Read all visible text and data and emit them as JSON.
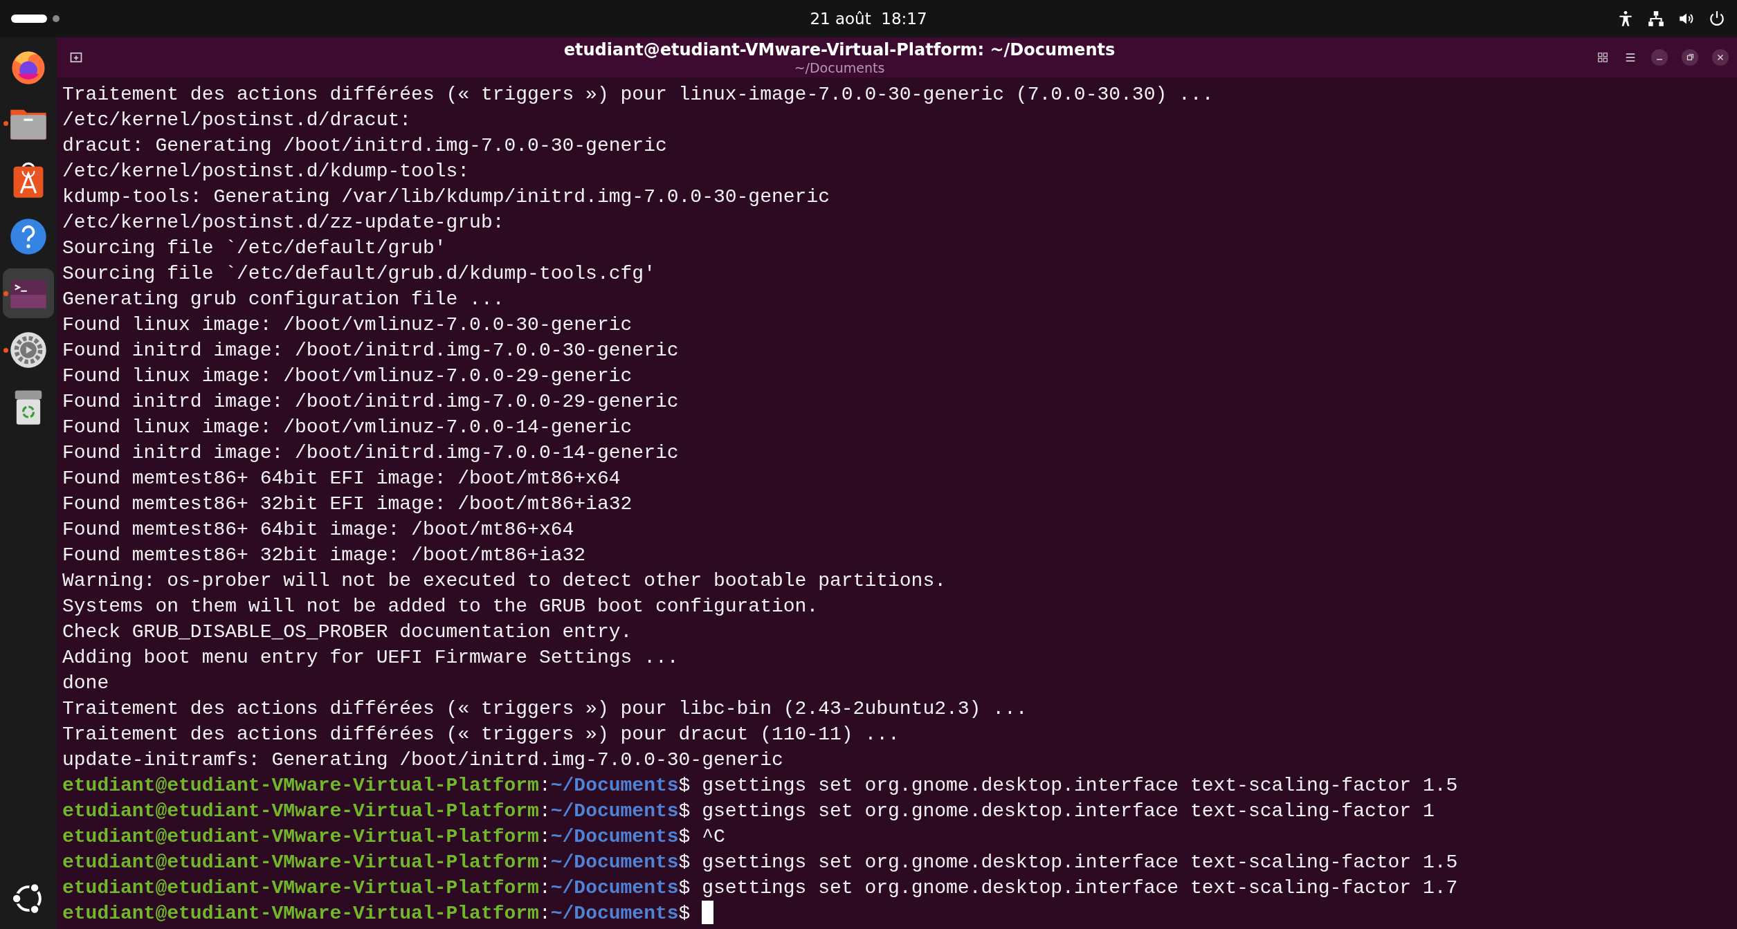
{
  "top_bar": {
    "clock": "21 août  18:17"
  },
  "dock": {
    "items": [
      {
        "kind": "firefox",
        "running": false,
        "selected": false
      },
      {
        "kind": "files",
        "running": true,
        "selected": false
      },
      {
        "kind": "store",
        "running": false,
        "selected": false
      },
      {
        "kind": "help",
        "running": false,
        "selected": false
      },
      {
        "kind": "terminal",
        "running": true,
        "selected": true
      },
      {
        "kind": "settings",
        "running": true,
        "selected": false
      },
      {
        "kind": "trash",
        "running": false,
        "selected": false
      }
    ]
  },
  "window": {
    "title": "etudiant@etudiant-VMware-Virtual-Platform: ~/Documents",
    "subtitle": "~/Documents"
  },
  "terminal": {
    "lines": [
      {
        "kind": "output",
        "text": "Traitement des actions différées (« triggers ») pour linux-image-7.0.0-30-generic (7.0.0-30.30) ..."
      },
      {
        "kind": "output",
        "text": "/etc/kernel/postinst.d/dracut:"
      },
      {
        "kind": "output",
        "text": "dracut: Generating /boot/initrd.img-7.0.0-30-generic"
      },
      {
        "kind": "output",
        "text": "/etc/kernel/postinst.d/kdump-tools:"
      },
      {
        "kind": "output",
        "text": "kdump-tools: Generating /var/lib/kdump/initrd.img-7.0.0-30-generic"
      },
      {
        "kind": "output",
        "text": "/etc/kernel/postinst.d/zz-update-grub:"
      },
      {
        "kind": "output",
        "text": "Sourcing file `/etc/default/grub'"
      },
      {
        "kind": "output",
        "text": "Sourcing file `/etc/default/grub.d/kdump-tools.cfg'"
      },
      {
        "kind": "output",
        "text": "Generating grub configuration file ..."
      },
      {
        "kind": "output",
        "text": "Found linux image: /boot/vmlinuz-7.0.0-30-generic"
      },
      {
        "kind": "output",
        "text": "Found initrd image: /boot/initrd.img-7.0.0-30-generic"
      },
      {
        "kind": "output",
        "text": "Found linux image: /boot/vmlinuz-7.0.0-29-generic"
      },
      {
        "kind": "output",
        "text": "Found initrd image: /boot/initrd.img-7.0.0-29-generic"
      },
      {
        "kind": "output",
        "text": "Found linux image: /boot/vmlinuz-7.0.0-14-generic"
      },
      {
        "kind": "output",
        "text": "Found initrd image: /boot/initrd.img-7.0.0-14-generic"
      },
      {
        "kind": "output",
        "text": "Found memtest86+ 64bit EFI image: /boot/mt86+x64"
      },
      {
        "kind": "output",
        "text": "Found memtest86+ 32bit EFI image: /boot/mt86+ia32"
      },
      {
        "kind": "output",
        "text": "Found memtest86+ 64bit image: /boot/mt86+x64"
      },
      {
        "kind": "output",
        "text": "Found memtest86+ 32bit image: /boot/mt86+ia32"
      },
      {
        "kind": "output",
        "text": "Warning: os-prober will not be executed to detect other bootable partitions."
      },
      {
        "kind": "output",
        "text": "Systems on them will not be added to the GRUB boot configuration."
      },
      {
        "kind": "output",
        "text": "Check GRUB_DISABLE_OS_PROBER documentation entry."
      },
      {
        "kind": "output",
        "text": "Adding boot menu entry for UEFI Firmware Settings ..."
      },
      {
        "kind": "output",
        "text": "done"
      },
      {
        "kind": "output",
        "text": "Traitement des actions différées (« triggers ») pour libc-bin (2.43-2ubuntu2.3) ..."
      },
      {
        "kind": "output",
        "text": "Traitement des actions différées (« triggers ») pour dracut (110-11) ..."
      },
      {
        "kind": "output",
        "text": "update-initramfs: Generating /boot/initrd.img-7.0.0-30-generic"
      },
      {
        "kind": "prompt",
        "user_host": "etudiant@etudiant-VMware-Virtual-Platform",
        "separator": ":",
        "path": "~/Documents",
        "symbol": "$",
        "command": "gsettings set org.gnome.desktop.interface text-scaling-factor 1.5",
        "cursor": false
      },
      {
        "kind": "prompt",
        "user_host": "etudiant@etudiant-VMware-Virtual-Platform",
        "separator": ":",
        "path": "~/Documents",
        "symbol": "$",
        "command": "gsettings set org.gnome.desktop.interface text-scaling-factor 1",
        "cursor": false
      },
      {
        "kind": "prompt",
        "user_host": "etudiant@etudiant-VMware-Virtual-Platform",
        "separator": ":",
        "path": "~/Documents",
        "symbol": "$",
        "command": "^C",
        "cursor": false
      },
      {
        "kind": "prompt",
        "user_host": "etudiant@etudiant-VMware-Virtual-Platform",
        "separator": ":",
        "path": "~/Documents",
        "symbol": "$",
        "command": "gsettings set org.gnome.desktop.interface text-scaling-factor 1.5",
        "cursor": false
      },
      {
        "kind": "prompt",
        "user_host": "etudiant@etudiant-VMware-Virtual-Platform",
        "separator": ":",
        "path": "~/Documents",
        "symbol": "$",
        "command": "gsettings set org.gnome.desktop.interface text-scaling-factor 1.7",
        "cursor": false
      },
      {
        "kind": "prompt",
        "user_host": "etudiant@etudiant-VMware-Virtual-Platform",
        "separator": ":",
        "path": "~/Documents",
        "symbol": "$",
        "cursor": true
      }
    ]
  }
}
